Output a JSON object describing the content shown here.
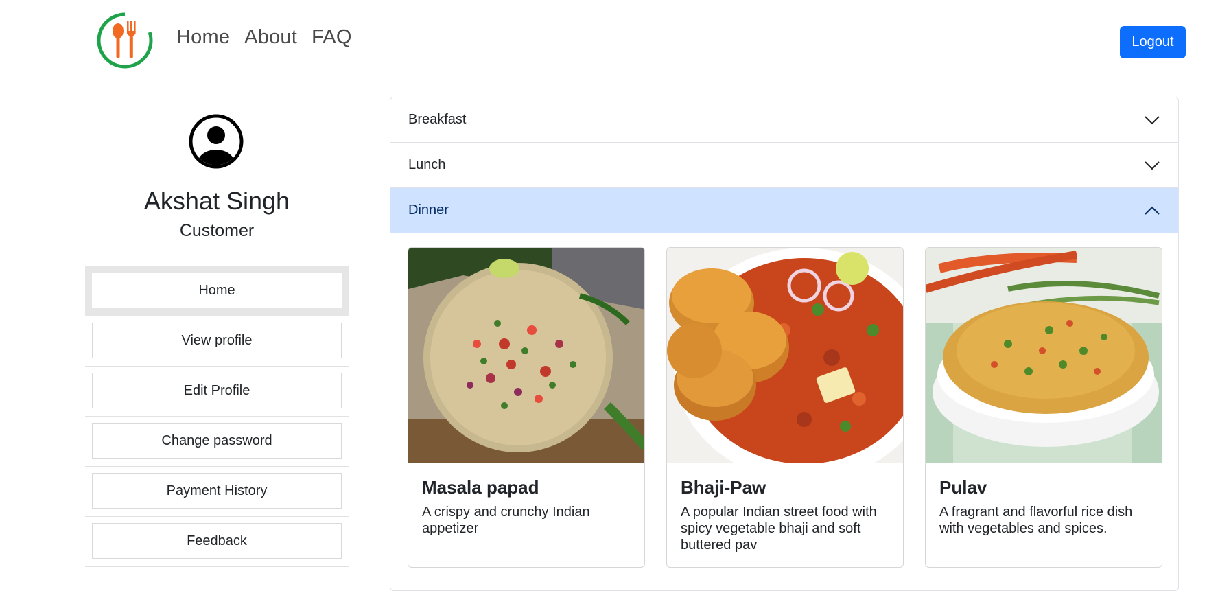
{
  "nav": {
    "links": [
      "Home",
      "About",
      "FAQ"
    ],
    "logout_label": "Logout",
    "logo_icon": "fork-spoon-logo-icon",
    "colors": {
      "logo_ring": "#1fa34a",
      "logo_cutlery": "#f26a21",
      "primary": "#0d6efd"
    }
  },
  "profile": {
    "avatar_icon": "user-circle-icon",
    "name": "Akshat Singh",
    "role": "Customer"
  },
  "sidebar": {
    "items": [
      {
        "label": "Home",
        "active": true
      },
      {
        "label": "View profile",
        "active": false
      },
      {
        "label": "Edit Profile",
        "active": false
      },
      {
        "label": "Change password",
        "active": false
      },
      {
        "label": "Payment History",
        "active": false
      },
      {
        "label": "Feedback",
        "active": false
      }
    ]
  },
  "menu": {
    "sections": [
      {
        "title": "Breakfast",
        "expanded": false
      },
      {
        "title": "Lunch",
        "expanded": false
      },
      {
        "title": "Dinner",
        "expanded": true
      }
    ],
    "dinner_items": [
      {
        "title": "Masala papad",
        "description": "A crispy and crunchy Indian appetizer",
        "image": "masala-papad-photo"
      },
      {
        "title": "Bhaji-Paw",
        "description": "A popular Indian street food with spicy vegetable bhaji and soft buttered pav",
        "image": "bhaji-paw-photo"
      },
      {
        "title": "Pulav",
        "description": "A fragrant and flavorful rice dish with vegetables and spices.",
        "image": "pulav-photo"
      }
    ],
    "colors": {
      "expanded_header": "#cfe2ff",
      "expanded_text": "#052c65"
    }
  }
}
